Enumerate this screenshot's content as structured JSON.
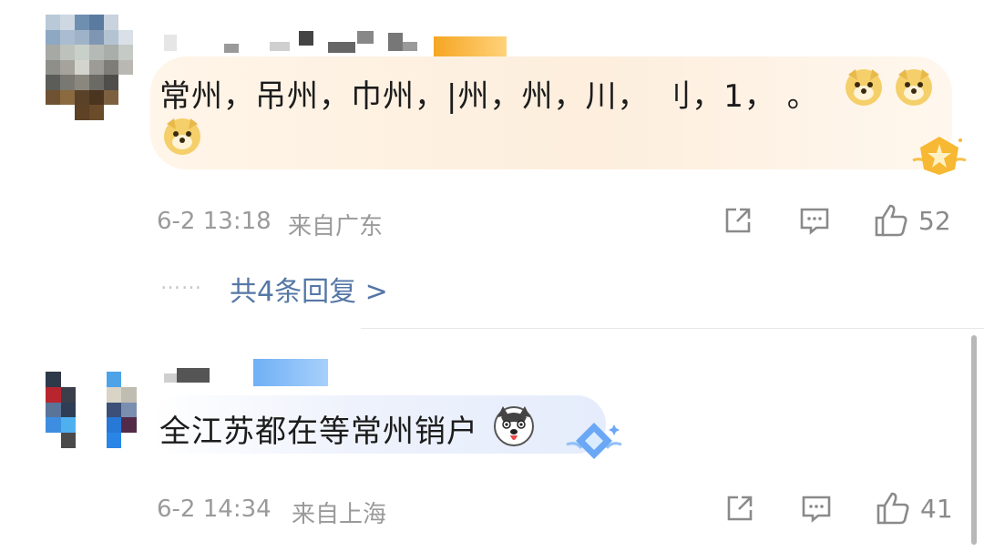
{
  "comments": [
    {
      "text": "常州，吊州，巾州，|州，州，川，  刂，1，  。",
      "time": "6-2 13:18",
      "location": "来自广东",
      "likes": "52",
      "replies_label": "共4条回复 >",
      "replies_dots": "……",
      "emoji": "doge-emoji",
      "badge": "gold-star-badge-icon"
    },
    {
      "text": "全江苏都在等常州销户",
      "time": "6-2 14:34",
      "location": "来自上海",
      "likes": "41",
      "emoji": "husky-emoji",
      "badge": "blue-diamond-badge-icon"
    }
  ],
  "colors": {
    "reply_link": "#5577a6",
    "meta": "#9a9a9a",
    "text": "#1c1c1c",
    "gold_bubble": "#fdf1df",
    "blue_bubble": "#e9eefb"
  }
}
